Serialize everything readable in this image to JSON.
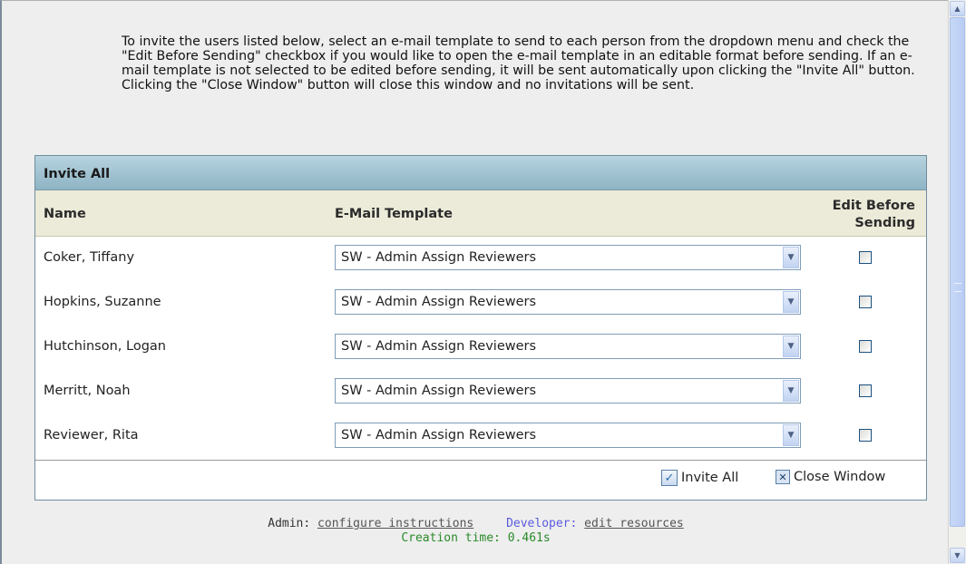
{
  "instructions": "To invite the users listed below, select an e-mail template to send to each person from the dropdown menu and check the \"Edit Before Sending\" checkbox if you would like to open the e-mail template in an editable format before sending. If an e-mail template is not selected to be edited before sending, it will be sent automatically upon clicking the \"Invite All\" button. Clicking the \"Close Window\" button will close this window and no invitations will be sent.",
  "panel": {
    "title": "Invite All",
    "columns": {
      "name": "Name",
      "template": "E-Mail Template",
      "edit_line1": "Edit Before",
      "edit_line2": "Sending"
    },
    "rows": [
      {
        "name": "Coker, Tiffany",
        "template": "SW - Admin Assign Reviewers",
        "edit_before_sending": false
      },
      {
        "name": "Hopkins, Suzanne",
        "template": "SW - Admin Assign Reviewers",
        "edit_before_sending": false
      },
      {
        "name": "Hutchinson, Logan",
        "template": "SW - Admin Assign Reviewers",
        "edit_before_sending": false
      },
      {
        "name": "Merritt, Noah",
        "template": "SW - Admin Assign Reviewers",
        "edit_before_sending": false
      },
      {
        "name": "Reviewer, Rita",
        "template": "SW - Admin Assign Reviewers",
        "edit_before_sending": false
      }
    ],
    "buttons": {
      "invite_all": "Invite All",
      "close_window": "Close Window"
    }
  },
  "footer": {
    "admin_label": "Admin:",
    "admin_link": "configure instructions",
    "developer_label": "Developer:",
    "developer_link": "edit resources",
    "creation_time": "Creation time: 0.461s"
  },
  "colors": {
    "panel_header": "#9fc0cf",
    "column_header": "#ecead8",
    "creation_time": "#2a8a2a",
    "developer_label": "#5a5ae0"
  }
}
